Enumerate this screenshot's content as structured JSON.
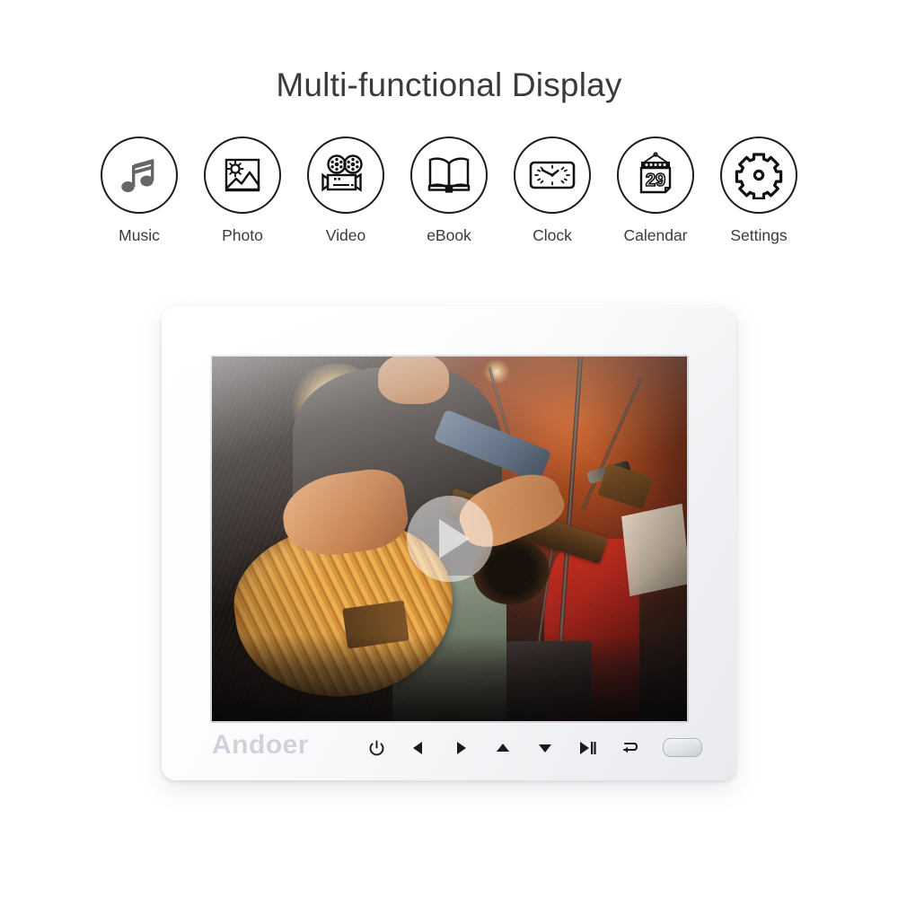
{
  "header": {
    "title": "Multi-functional Display"
  },
  "features": [
    {
      "label": "Music",
      "icon": "music-note-icon"
    },
    {
      "label": "Photo",
      "icon": "photo-image-icon"
    },
    {
      "label": "Video",
      "icon": "movie-camera-icon"
    },
    {
      "label": "eBook",
      "icon": "open-book-icon"
    },
    {
      "label": "Clock",
      "icon": "clock-icon"
    },
    {
      "label": "Calendar",
      "icon": "calendar-icon"
    },
    {
      "label": "Settings",
      "icon": "gear-icon"
    }
  ],
  "calendar_icon": {
    "day_number": "29"
  },
  "device": {
    "brand": "Andoer",
    "frame_color": "#f4f5f7",
    "screen": {
      "media_type": "video",
      "overlay_icon": "play-button-icon",
      "scene_description": "Musician playing an acoustic guitar on a dark stage under warm orange stage lighting"
    },
    "controls": [
      {
        "name": "power",
        "icon": "power-icon",
        "label": "Power"
      },
      {
        "name": "left",
        "icon": "left-arrow-icon",
        "label": "Left"
      },
      {
        "name": "right",
        "icon": "right-arrow-icon",
        "label": "Right"
      },
      {
        "name": "up",
        "icon": "up-arrow-icon",
        "label": "Up"
      },
      {
        "name": "down",
        "icon": "down-arrow-icon",
        "label": "Down"
      },
      {
        "name": "play-pause",
        "icon": "play-pause-icon",
        "label": "Play/Pause"
      },
      {
        "name": "return",
        "icon": "return-arrow-icon",
        "label": "Return"
      }
    ],
    "sensor": {
      "name": "ir-sensor"
    }
  },
  "colors": {
    "background": "#ffffff",
    "title_text": "#3a3a3a",
    "icon_outline": "#1c1c1c",
    "brand_text": "#cfd3d9"
  }
}
